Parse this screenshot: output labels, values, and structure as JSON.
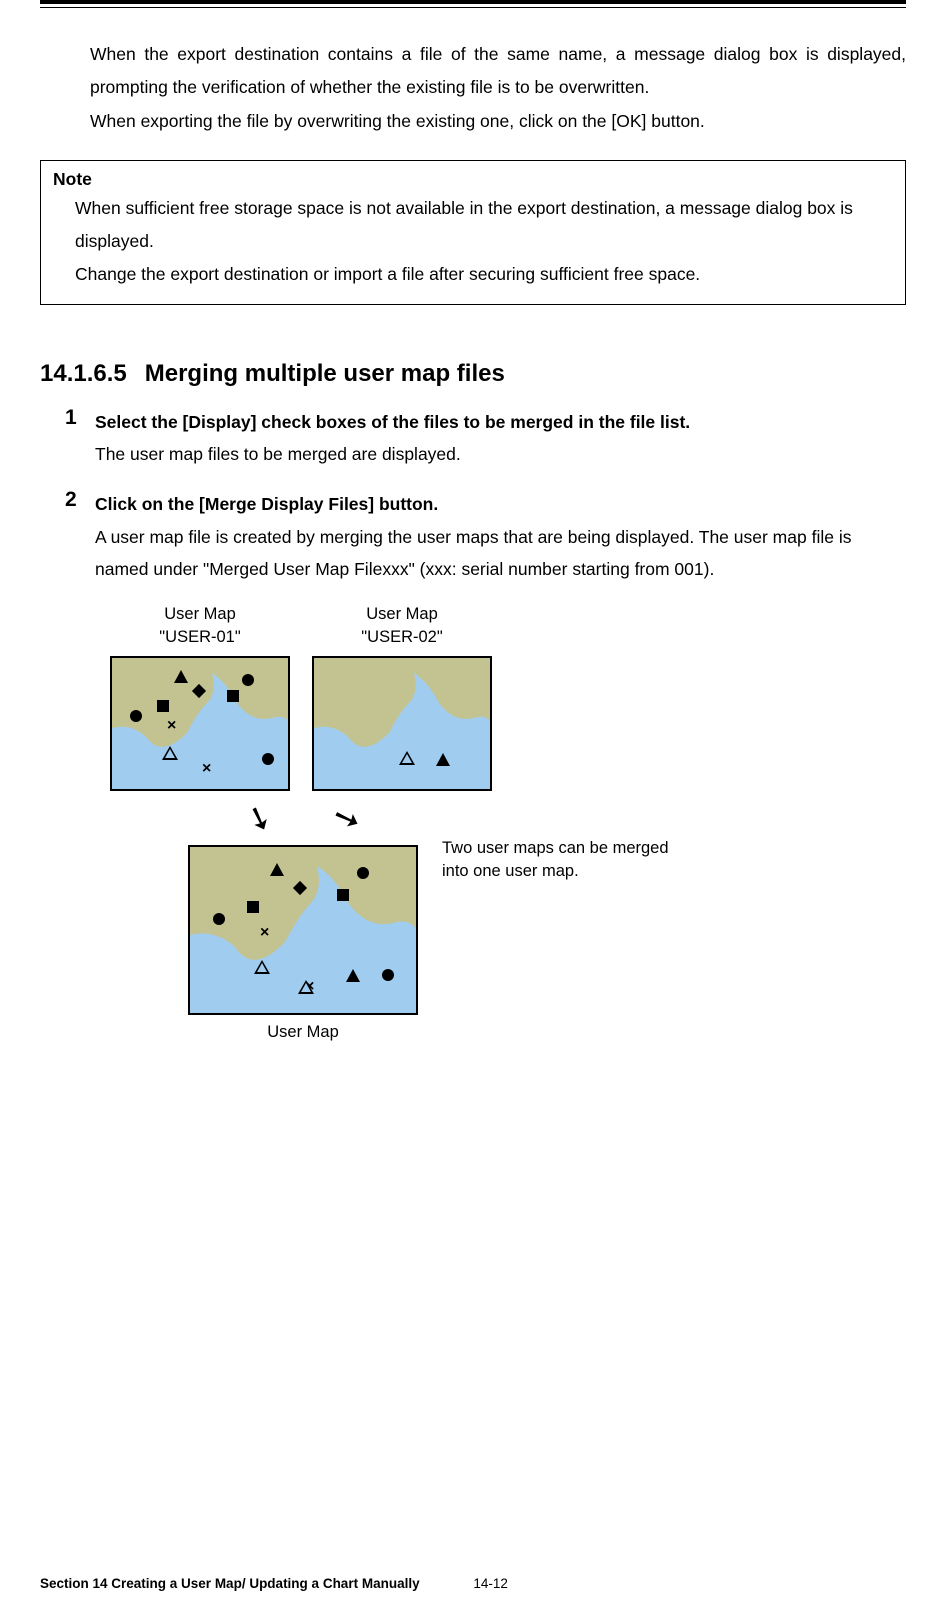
{
  "intro": {
    "p1": "When the export destination contains a file of the same name, a message dialog box is displayed, prompting the verification of whether the existing file is to be overwritten.",
    "p2": "When exporting the file by overwriting the existing one, click on the [OK] button."
  },
  "note": {
    "title": "Note",
    "p1": "When sufficient free storage space is not available in the export destination, a message dialog box is displayed.",
    "p2": "Change the export destination or import a file after securing sufficient free space."
  },
  "section": {
    "number": "14.1.6.5",
    "title": "Merging multiple user map files"
  },
  "steps": [
    {
      "num": "1",
      "title": "Select the [Display] check boxes of the files to be merged in the file list.",
      "body": "The user map files to be merged are displayed."
    },
    {
      "num": "2",
      "title": "Click on the [Merge Display Files] button.",
      "body": "A user map file is created by merging the user maps that are being displayed. The user map file is named under \"Merged User Map Filexxx\" (xxx: serial number starting from 001)."
    }
  ],
  "diagram": {
    "map1_label_l1": "User Map",
    "map1_label_l2": "\"USER-01\"",
    "map2_label_l1": "User Map",
    "map2_label_l2": "\"USER-02\"",
    "merge_caption_l1": "Two user maps can be merged",
    "merge_caption_l2": "into one user map.",
    "merged_label": "User Map"
  },
  "footer": {
    "section": "Section 14    Creating a User Map/ Updating a Chart Manually",
    "page": "14-12"
  }
}
